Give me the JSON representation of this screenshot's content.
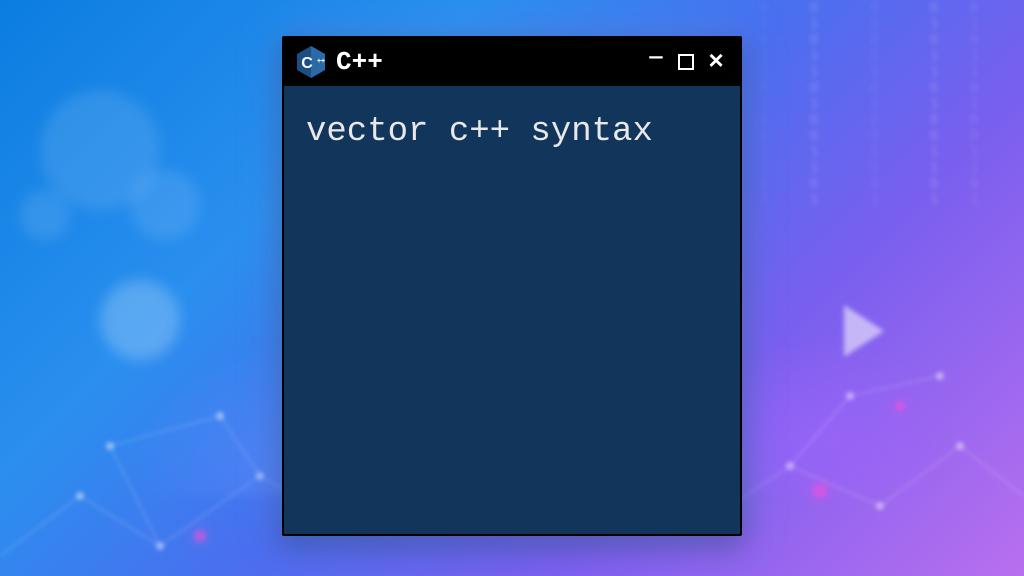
{
  "window": {
    "title": "C++",
    "logo_letter": "C",
    "logo_plus": "++",
    "content_text": "vector c++ syntax"
  },
  "colors": {
    "window_bg": "#12355b",
    "titlebar_bg": "#000000",
    "text": "#e8e8e8",
    "logo_hex": "#0f3a66",
    "logo_hex_light": "#2a6aa8"
  },
  "bg_rain": "0\n1\n0\n1\n1\n0\n1\n0\n0\n1\n1\n0\n1"
}
